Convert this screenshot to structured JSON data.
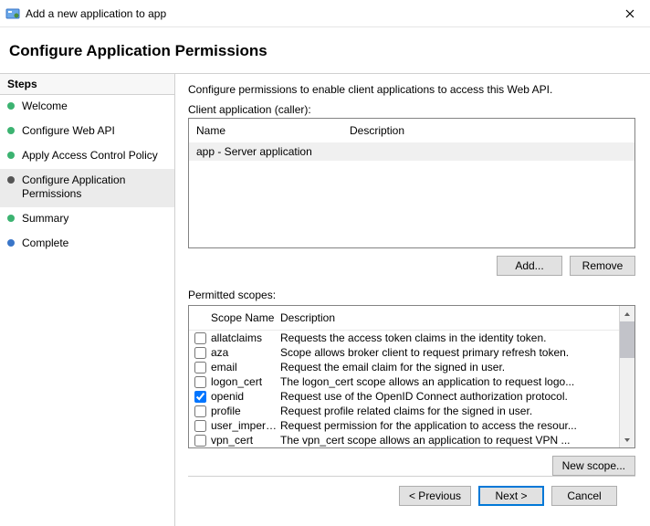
{
  "window": {
    "title": "Add a new application to app"
  },
  "heading": "Configure Application Permissions",
  "sidebar": {
    "header": "Steps",
    "items": [
      {
        "label": "Welcome"
      },
      {
        "label": "Configure Web API"
      },
      {
        "label": "Apply Access Control Policy"
      },
      {
        "label": "Configure Application Permissions"
      },
      {
        "label": "Summary"
      },
      {
        "label": "Complete"
      }
    ]
  },
  "main": {
    "intro": "Configure permissions to enable client applications to access this Web API.",
    "client_label": "Client application (caller):",
    "client_cols": {
      "name": "Name",
      "desc": "Description"
    },
    "client_rows": [
      {
        "name": "app - Server application",
        "desc": ""
      }
    ],
    "btn_add": "Add...",
    "btn_remove": "Remove",
    "scopes_label": "Permitted scopes:",
    "scopes_cols": {
      "name": "Scope Name",
      "desc": "Description"
    },
    "scopes": [
      {
        "checked": false,
        "name": "allatclaims",
        "desc": "Requests the access token claims in the identity token."
      },
      {
        "checked": false,
        "name": "aza",
        "desc": "Scope allows broker client to request primary refresh token."
      },
      {
        "checked": false,
        "name": "email",
        "desc": "Request the email claim for the signed in user."
      },
      {
        "checked": false,
        "name": "logon_cert",
        "desc": "The logon_cert scope allows an application to request logo..."
      },
      {
        "checked": true,
        "name": "openid",
        "desc": "Request use of the OpenID Connect authorization protocol."
      },
      {
        "checked": false,
        "name": "profile",
        "desc": "Request profile related claims for the signed in user."
      },
      {
        "checked": false,
        "name": "user_imperso...",
        "desc": "Request permission for the application to access the resour..."
      },
      {
        "checked": false,
        "name": "vpn_cert",
        "desc": "The vpn_cert scope allows an application to request VPN ..."
      }
    ],
    "btn_newscope": "New scope..."
  },
  "wizard": {
    "prev": "< Previous",
    "next": "Next >",
    "cancel": "Cancel"
  }
}
